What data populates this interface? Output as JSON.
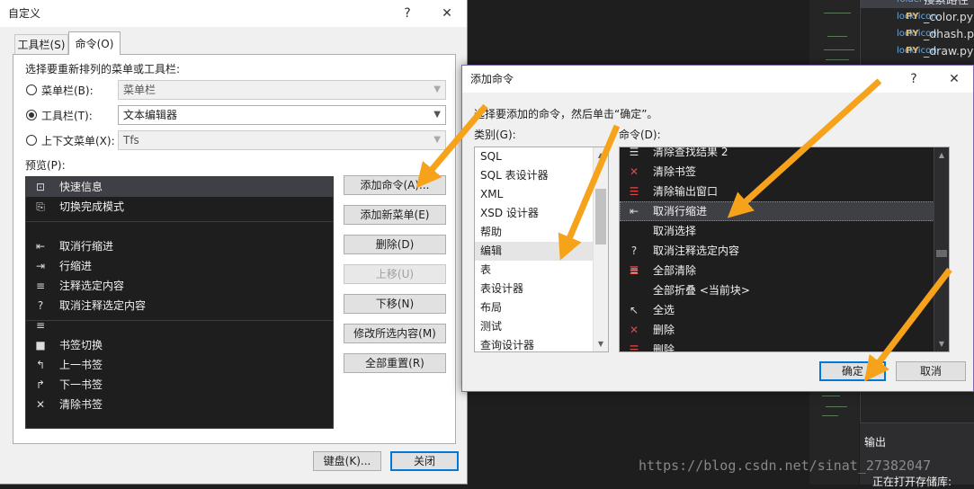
{
  "colors": {
    "accent": "#0078d7",
    "annotation_arrow": "#f7a21b",
    "ide_background": "#1e1e1e",
    "dialog_background": "#f0f0f0"
  },
  "ide": {
    "solution_files": [
      {
        "name": "搜索路径",
        "badge": "",
        "icon": "folder-icon"
      },
      {
        "name": "_color.py",
        "badge": "PY",
        "icon": "lock-icon"
      },
      {
        "name": "_dhash.py",
        "badge": "PY",
        "icon": "lock-icon"
      },
      {
        "name": "_draw.py",
        "badge": "PY",
        "icon": "lock-icon"
      }
    ],
    "output_title": "输出",
    "output_text": "正在打开存储库:",
    "watermark": "https://blog.csdn.net/sinat_27382047"
  },
  "customize_dialog": {
    "title": "自定义",
    "help": "?",
    "close": "✕",
    "tabs": [
      {
        "label": "工具栏(S)",
        "active": false
      },
      {
        "label": "命令(O)",
        "active": true
      }
    ],
    "choose_label": "选择要重新排列的菜单或工具栏:",
    "radios": [
      {
        "label": "菜单栏(B):",
        "selected": false,
        "value": "菜单栏",
        "enabled": false
      },
      {
        "label": "工具栏(T):",
        "selected": true,
        "value": "文本编辑器",
        "enabled": true
      },
      {
        "label": "上下文菜单(X):",
        "selected": false,
        "value": "Tfs",
        "enabled": false
      }
    ],
    "preview_label": "预览(P):",
    "preview_items": [
      {
        "label": "快速信息",
        "icon": "quick-info-icon",
        "glyph": "⊡"
      },
      {
        "label": "切换完成模式",
        "icon": "completion-mode-icon",
        "glyph": "⎘"
      },
      {
        "label": "取消行缩进",
        "icon": "outdent-icon",
        "glyph": "⇤"
      },
      {
        "label": "行缩进",
        "icon": "indent-icon",
        "glyph": "⇥"
      },
      {
        "label": "注释选定内容",
        "icon": "comment-icon",
        "glyph": "≡"
      },
      {
        "label": "取消注释选定内容",
        "icon": "uncomment-icon",
        "glyph": "?≡"
      },
      {
        "label": "书签切换",
        "icon": "bookmark-icon",
        "glyph": "■"
      },
      {
        "label": "上一书签",
        "icon": "prev-bookmark-icon",
        "glyph": "↰"
      },
      {
        "label": "下一书签",
        "icon": "next-bookmark-icon",
        "glyph": "↱"
      },
      {
        "label": "清除书签",
        "icon": "clear-bookmarks-icon",
        "glyph": "✕"
      }
    ],
    "buttons": {
      "add_command": "添加命令(A)...",
      "add_menu": "添加新菜单(E)",
      "delete": "删除(D)",
      "move_up": "上移(U)",
      "move_down": "下移(N)",
      "modify": "修改所选内容(M)",
      "reset_all": "全部重置(R)",
      "keyboard": "键盘(K)...",
      "close": "关闭"
    }
  },
  "add_command_dialog": {
    "title": "添加命令",
    "help": "?",
    "close": "✕",
    "instruction": "选择要添加的命令，然后单击“确定”。",
    "category_label": "类别(G):",
    "command_label": "命令(D):",
    "categories": [
      {
        "label": "SQL",
        "selected": false
      },
      {
        "label": "SQL 表设计器",
        "selected": false
      },
      {
        "label": "XML",
        "selected": false
      },
      {
        "label": "XSD 设计器",
        "selected": false
      },
      {
        "label": "帮助",
        "selected": false
      },
      {
        "label": "编辑",
        "selected": true
      },
      {
        "label": "表",
        "selected": false
      },
      {
        "label": "表设计器",
        "selected": false
      },
      {
        "label": "布局",
        "selected": false
      },
      {
        "label": "测试",
        "selected": false
      },
      {
        "label": "查询设计器",
        "selected": false
      }
    ],
    "commands": [
      {
        "label": "清除查找结果 2",
        "icon": "clear-find-results-icon",
        "glyph": "☰",
        "red": false,
        "selected": false
      },
      {
        "label": "清除书签",
        "icon": "clear-bookmarks-icon",
        "glyph": "✕",
        "red": true,
        "selected": false
      },
      {
        "label": "清除输出窗口",
        "icon": "clear-output-icon",
        "glyph": "☰",
        "red": true,
        "selected": false
      },
      {
        "label": "取消行缩进",
        "icon": "outdent-icon",
        "glyph": "⇤",
        "red": false,
        "selected": true
      },
      {
        "label": "取消选择",
        "icon": "",
        "glyph": "",
        "red": false,
        "selected": false
      },
      {
        "label": "取消注释选定内容",
        "icon": "uncomment-icon",
        "glyph": "?≡",
        "red": false,
        "selected": false
      },
      {
        "label": "全部清除",
        "icon": "clear-all-icon",
        "glyph": "☰",
        "red": true,
        "selected": false
      },
      {
        "label": "全部折叠 <当前块>",
        "icon": "",
        "glyph": "",
        "red": false,
        "selected": false
      },
      {
        "label": "全选",
        "icon": "select-all-icon",
        "glyph": "↖",
        "red": false,
        "selected": false
      },
      {
        "label": "删除",
        "icon": "delete-icon",
        "glyph": "✕",
        "red": true,
        "selected": false
      },
      {
        "label": "删除",
        "icon": "delete-lines-icon",
        "glyph": "☰",
        "red": true,
        "selected": false
      }
    ],
    "ok": "确定",
    "cancel": "取消"
  }
}
